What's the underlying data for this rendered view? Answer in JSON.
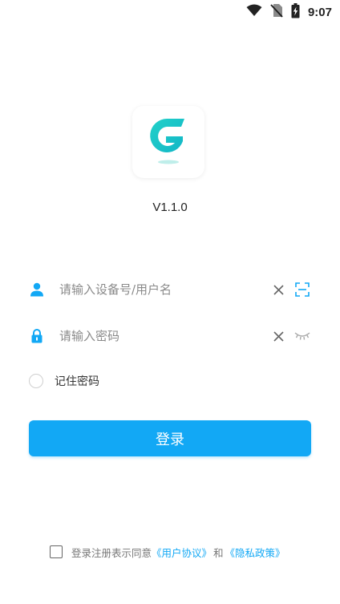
{
  "status_bar": {
    "time": "9:07",
    "icons": [
      "wifi-icon",
      "no-sim-icon",
      "battery-charging-icon"
    ]
  },
  "app": {
    "logo_icon": "app-logo-g-icon",
    "version": "V1.1.0"
  },
  "login_form": {
    "username": {
      "icon": "user-icon",
      "placeholder": "请输入设备号/用户名",
      "value": "",
      "clear_icon": "close-icon",
      "aux_icon": "scan-icon"
    },
    "password": {
      "icon": "lock-icon",
      "placeholder": "请输入密码",
      "value": "",
      "clear_icon": "close-icon",
      "aux_icon": "eye-closed-icon"
    },
    "remember_label": "记住密码",
    "remember_checked": false,
    "login_label": "登录"
  },
  "agreement": {
    "checked": false,
    "prefix": "登录注册表示同意",
    "user_agreement": "《用户协议》",
    "conjunction": "和",
    "privacy_policy": "《隐私政策》"
  },
  "colors": {
    "accent": "#12a8f5",
    "logo_teal": "#1cc6c6",
    "text_primary": "#222222",
    "placeholder": "#8a8a8a"
  }
}
